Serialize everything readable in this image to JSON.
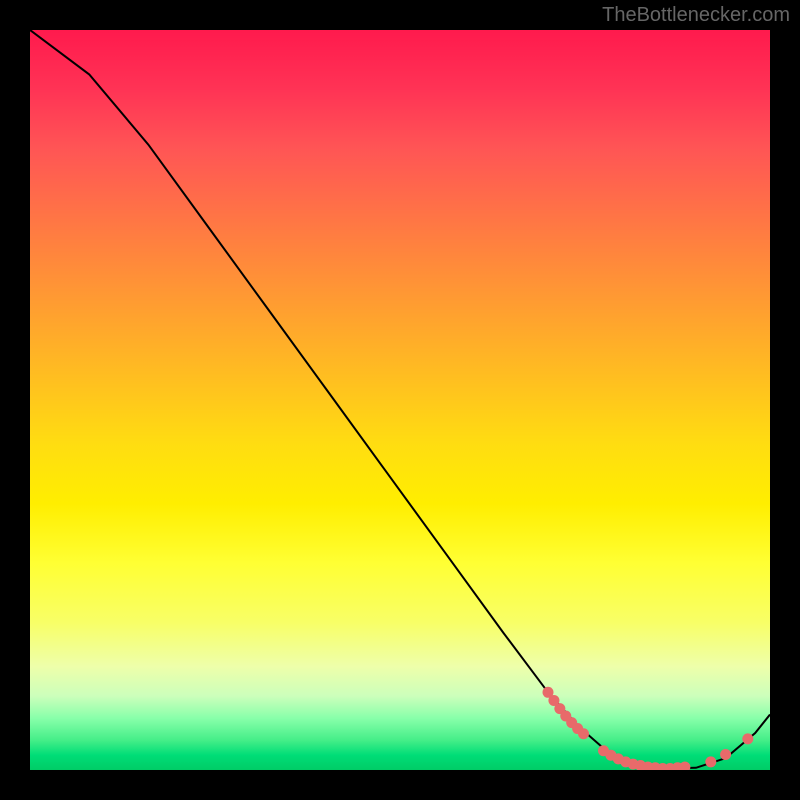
{
  "attribution": "TheBottlenecker.com",
  "chart_data": {
    "type": "line",
    "title": "",
    "xlabel": "",
    "ylabel": "",
    "xlim": [
      0,
      100
    ],
    "ylim": [
      0,
      100
    ],
    "series": [
      {
        "name": "bottleneck-curve",
        "x": [
          0,
          8,
          16,
          24,
          32,
          40,
          48,
          56,
          64,
          70,
          74,
          78,
          82,
          86,
          90,
          94,
          98,
          100
        ],
        "y": [
          100,
          94,
          84.5,
          73.5,
          62.5,
          51.5,
          40.5,
          29.5,
          18.5,
          10.5,
          6.0,
          2.5,
          0.8,
          0.2,
          0.3,
          1.6,
          5.0,
          7.5
        ],
        "color": "#000000"
      }
    ],
    "marker_clusters": [
      {
        "name": "left-cluster",
        "color": "#e86a6a",
        "points": [
          {
            "x": 70.0,
            "y": 10.5
          },
          {
            "x": 70.8,
            "y": 9.4
          },
          {
            "x": 71.6,
            "y": 8.3
          },
          {
            "x": 72.4,
            "y": 7.3
          },
          {
            "x": 73.2,
            "y": 6.4
          },
          {
            "x": 74.0,
            "y": 5.6
          },
          {
            "x": 74.8,
            "y": 4.9
          }
        ]
      },
      {
        "name": "bottom-cluster",
        "color": "#e86a6a",
        "points": [
          {
            "x": 77.5,
            "y": 2.6
          },
          {
            "x": 78.5,
            "y": 2.0
          },
          {
            "x": 79.5,
            "y": 1.5
          },
          {
            "x": 80.5,
            "y": 1.1
          },
          {
            "x": 81.5,
            "y": 0.8
          },
          {
            "x": 82.5,
            "y": 0.6
          },
          {
            "x": 83.5,
            "y": 0.4
          },
          {
            "x": 84.5,
            "y": 0.3
          },
          {
            "x": 85.5,
            "y": 0.2
          },
          {
            "x": 86.5,
            "y": 0.2
          },
          {
            "x": 87.5,
            "y": 0.3
          },
          {
            "x": 88.5,
            "y": 0.4
          }
        ]
      },
      {
        "name": "right-cluster",
        "color": "#e86a6a",
        "points": [
          {
            "x": 92.0,
            "y": 1.1
          },
          {
            "x": 94.0,
            "y": 2.1
          },
          {
            "x": 97.0,
            "y": 4.2
          }
        ]
      }
    ]
  }
}
